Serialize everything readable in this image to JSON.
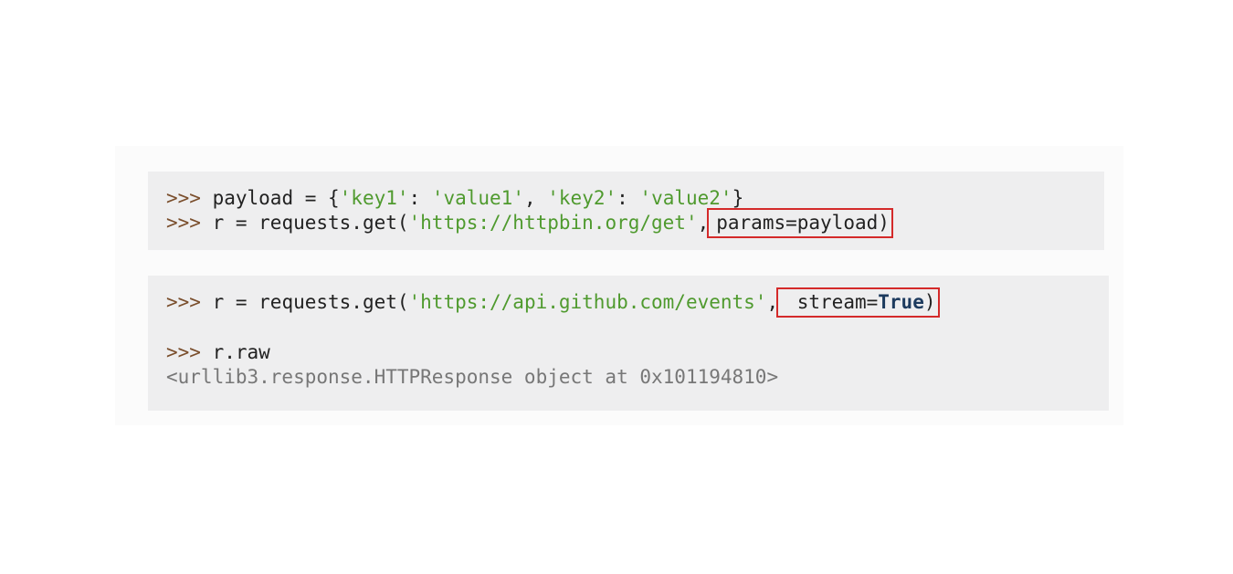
{
  "block1": {
    "line1": {
      "prompt": ">>>",
      "code_a": " payload = {",
      "str_key1": "'key1'",
      "code_b": ": ",
      "str_value1": "'value1'",
      "code_c": ", ",
      "str_key2": "'key2'",
      "code_d": ": ",
      "str_value2": "'value2'",
      "code_e": "}"
    },
    "line2": {
      "prompt": ">>>",
      "code_a": " r = requests.get(",
      "str_url": "'https://httpbin.org/get'",
      "code_b": ",",
      "highlight": "params=payload)"
    }
  },
  "block2": {
    "line1": {
      "prompt": ">>>",
      "code_a": " r = requests.get(",
      "str_url": "'https://api.github.com/events'",
      "code_b": ",",
      "hl_code": " stream=",
      "hl_kw": "True",
      "hl_paren": ")"
    },
    "line2": {
      "prompt": ">>>",
      "code": " r.raw"
    },
    "output": "<urllib3.response.HTTPResponse object at 0x101194810>"
  },
  "colors": {
    "prompt": "#7a4e2c",
    "string": "#4f9a2e",
    "keyword": "#1d3b5e",
    "highlight_box": "#d42a2a",
    "code_background": "#eeeeef"
  }
}
